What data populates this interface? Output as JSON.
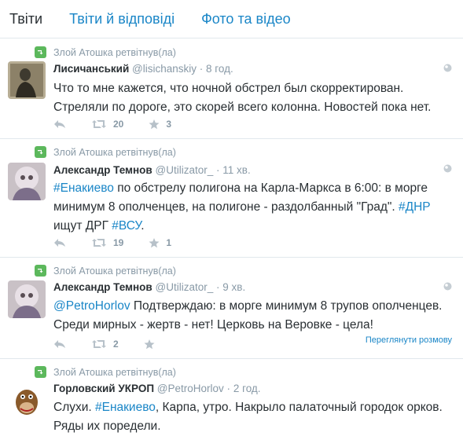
{
  "tabs": [
    "Твіти",
    "Твіти й відповіді",
    "Фото та відео"
  ],
  "tweets": [
    {
      "rt": "Злой Атошка ретвітнув(ла)",
      "name": "Лисичанський",
      "user": "@lisichanskiy",
      "dot": "·",
      "time": "8 год.",
      "line1": "Что то мне кажется, что ночной обстрел был скорректирован.",
      "line2": "Стреляли по дороге, это скорей  всего колонна. Новостей пока нет.",
      "retweets": "20",
      "favorites": "3"
    },
    {
      "rt": "Злой Атошка ретвітнув(ла)",
      "name": "Александр Темнов",
      "user": "@Utilizator_",
      "dot": "·",
      "time": "11 хв.",
      "hash1": "#Енакиево",
      "t1": " по обстрелу полигона на Карла-Маркса в 6:00: в морге",
      "t2": "минимум 8 ополченцев, на полигоне - раздолбанный \"Град\". ",
      "hash2": "#ДНР",
      "t3": "ищут ДРГ ",
      "hash3": "#ВСУ",
      "t4": ".",
      "retweets": "19",
      "favorites": "1"
    },
    {
      "rt": "Злой Атошка ретвітнув(ла)",
      "name": "Александр Темнов",
      "user": "@Utilizator_",
      "dot": "·",
      "time": "9 хв.",
      "mention": "@PetroHorlov",
      "t1": " Подтверждаю: в морге минимум 8 трупов ополченцев.",
      "t2": "Среди мирных - жертв - нет! Церковь на Веровке - цела!",
      "retweets": "2",
      "conversation": "Переглянути розмову"
    },
    {
      "rt": "Злой Атошка ретвітнув(ла)",
      "name": "Горловский УКРОП",
      "user": "@PetroHorlov",
      "dot": "·",
      "time": "2 год.",
      "t0": "Слухи. ",
      "hash1": "#Енакиево",
      "t1": ", Карпа, утро. Накрыло палаточный городок орков.",
      "t2": "Ряды их поредели."
    }
  ]
}
